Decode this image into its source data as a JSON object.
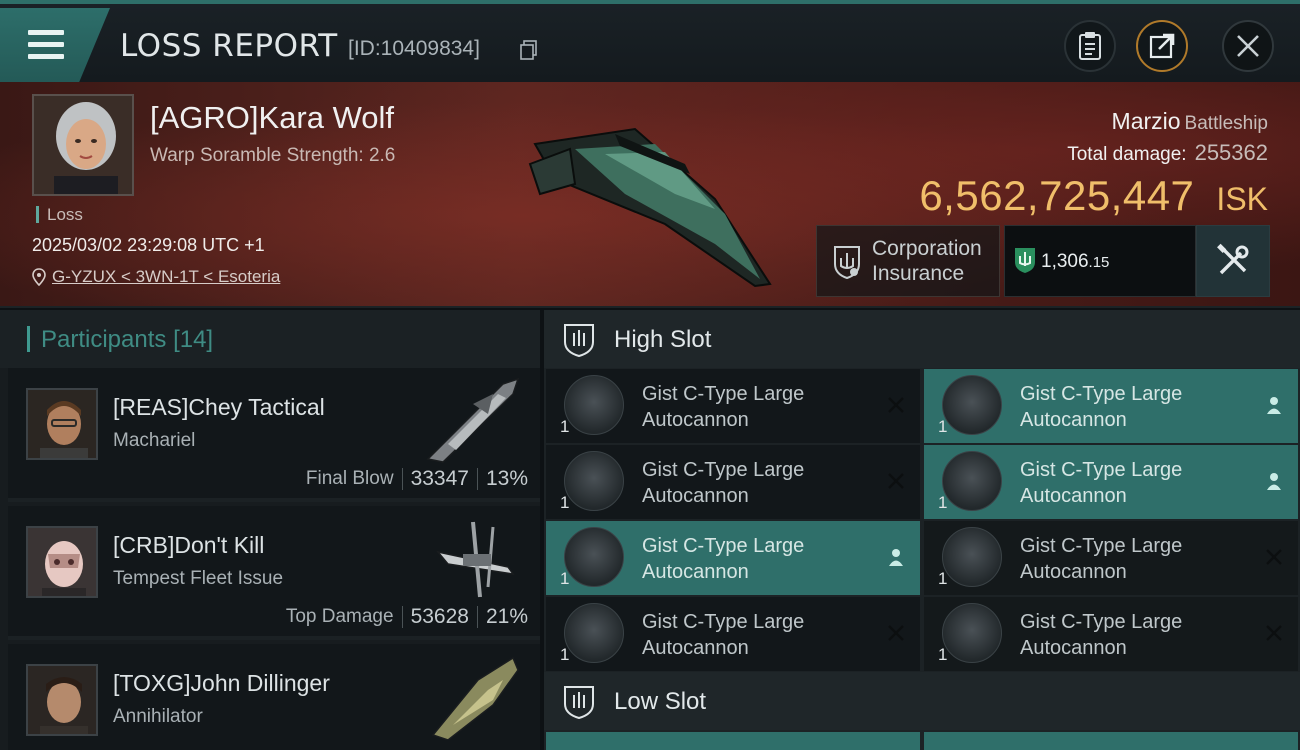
{
  "header": {
    "title": "LOSS REPORT",
    "report_id": "[ID:10409834]",
    "icons": [
      "menu-icon",
      "copy-icon",
      "clipboard-icon",
      "share-icon",
      "close-icon"
    ]
  },
  "victim": {
    "name": "[AGRO]Kara Wolf",
    "scramble": "Warp Soramble Strength: 2.6",
    "status": "Loss",
    "timestamp": "2025/03/02 23:29:08 UTC +1",
    "location": "G-YZUX < 3WN-1T < Esoteria",
    "ship_name": "Marzio",
    "ship_class": "Battleship",
    "total_damage_label": "Total damage:",
    "total_damage": "255362",
    "isk_value": "6,562,725,447",
    "isk_unit": "ISK",
    "insurance_label_1": "Corporation",
    "insurance_label_2": "Insurance",
    "insured_value": "1,306",
    "insured_decimal": ".15"
  },
  "participants": {
    "label": "Participants",
    "count": "[14]",
    "rows": [
      {
        "name": "[REAS]Chey Tactical",
        "ship": "Machariel",
        "tag": "Final Blow",
        "damage": "33347",
        "percent": "13%"
      },
      {
        "name": "[CRB]Don't Kill",
        "ship": "Tempest Fleet Issue",
        "tag": "Top Damage",
        "damage": "53628",
        "percent": "21%"
      },
      {
        "name": "[TOXG]John Dillinger",
        "ship": "Annihilator",
        "tag": "",
        "damage": "",
        "percent": ""
      }
    ]
  },
  "fitting": {
    "high_slot_label": "High Slot",
    "low_slot_label": "Low Slot",
    "modules": [
      {
        "line1": "Gist C-Type Large",
        "line2": "Autocannon",
        "qty": "1",
        "state": "destroyed"
      },
      {
        "line1": "Gist C-Type Large",
        "line2": "Autocannon",
        "qty": "1",
        "state": "dropped"
      },
      {
        "line1": "Gist C-Type Large",
        "line2": "Autocannon",
        "qty": "1",
        "state": "destroyed"
      },
      {
        "line1": "Gist C-Type Large",
        "line2": "Autocannon",
        "qty": "1",
        "state": "dropped"
      },
      {
        "line1": "Gist C-Type Large",
        "line2": "Autocannon",
        "qty": "1",
        "state": "dropped"
      },
      {
        "line1": "Gist C-Type Large",
        "line2": "Autocannon",
        "qty": "1",
        "state": "destroyed"
      },
      {
        "line1": "Gist C-Type Large",
        "line2": "Autocannon",
        "qty": "1",
        "state": "destroyed"
      },
      {
        "line1": "Gist C-Type Large",
        "line2": "Autocannon",
        "qty": "1",
        "state": "destroyed"
      }
    ]
  },
  "colors": {
    "accent_teal": "#2f6f6a",
    "isk_gold": "#f0be6a",
    "banner_red": "#5b2620"
  }
}
